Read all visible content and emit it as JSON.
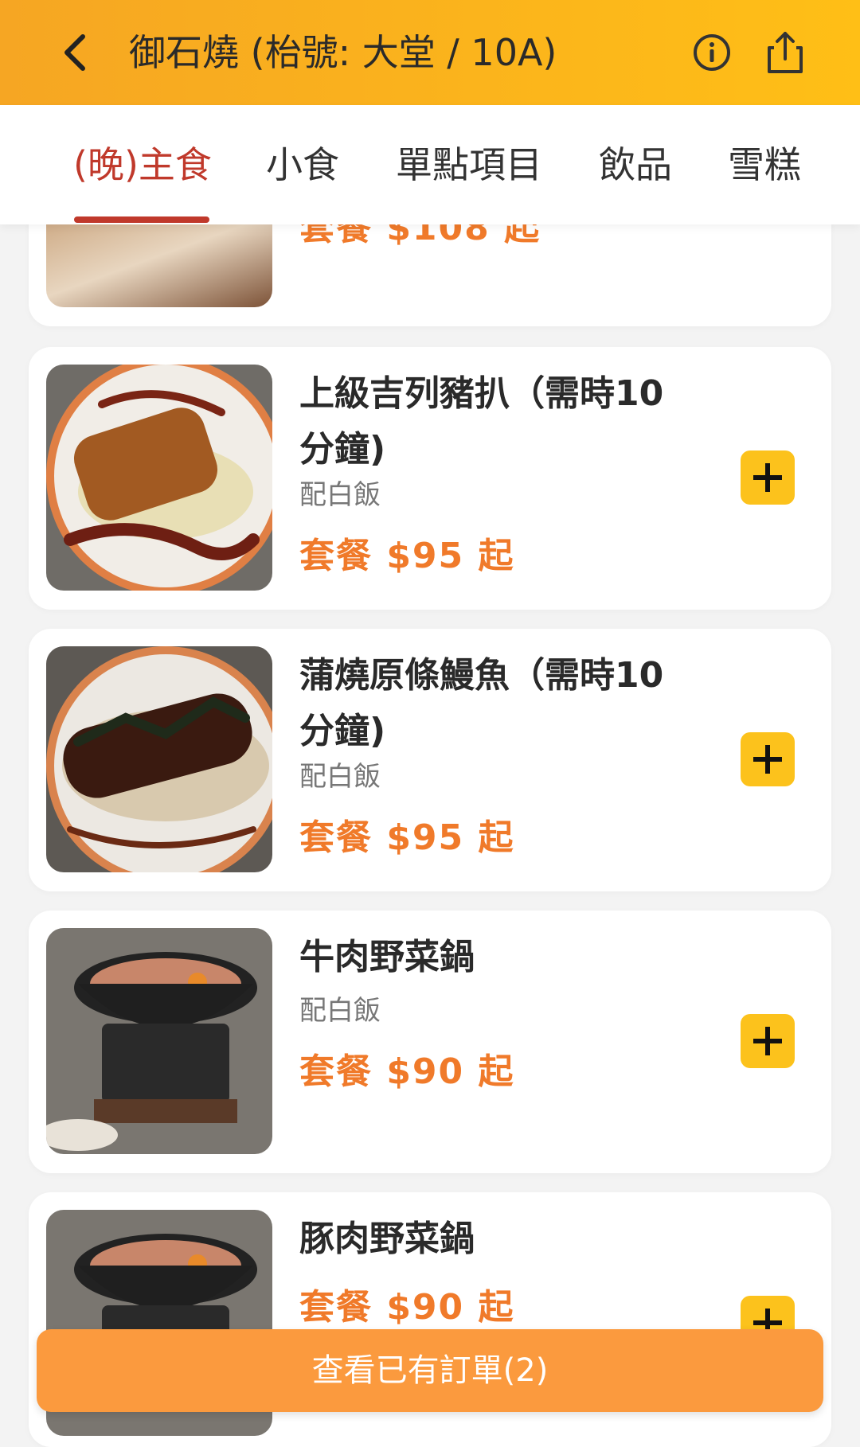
{
  "header": {
    "title": "御石燒 (枱號: 大堂 / 10A)",
    "back_icon": "chevron-left-icon",
    "info_icon": "info-icon",
    "share_icon": "share-icon"
  },
  "tabs": [
    {
      "label": "(晚)主食",
      "active": true
    },
    {
      "label": "小食",
      "active": false
    },
    {
      "label": "單點項目",
      "active": false
    },
    {
      "label": "飲品",
      "active": false
    },
    {
      "label": "雪糕",
      "active": false
    }
  ],
  "menu": {
    "partial_top_item": {
      "price": "套餐 $108 起"
    },
    "items": [
      {
        "name": "上級吉列豬扒（需時10分鐘)",
        "sub": "配白飯",
        "price": "套餐 $95 起"
      },
      {
        "name": "蒲燒原條鰻魚（需時10分鐘)",
        "sub": "配白飯",
        "price": "套餐 $95 起"
      },
      {
        "name": "牛肉野菜鍋",
        "sub": "配白飯",
        "price": "套餐 $90 起"
      },
      {
        "name": "豚肉野菜鍋",
        "sub": "",
        "price": "套餐 $90 起"
      }
    ]
  },
  "order_bar": {
    "label": "查看已有訂單(2)"
  },
  "colors": {
    "header_gradient_start": "#f6a623",
    "header_gradient_end": "#ffbf16",
    "active_tab": "#c0392b",
    "price": "#f07a2a",
    "add_button": "#fcc21c",
    "order_bar": "#fb9a3e"
  }
}
